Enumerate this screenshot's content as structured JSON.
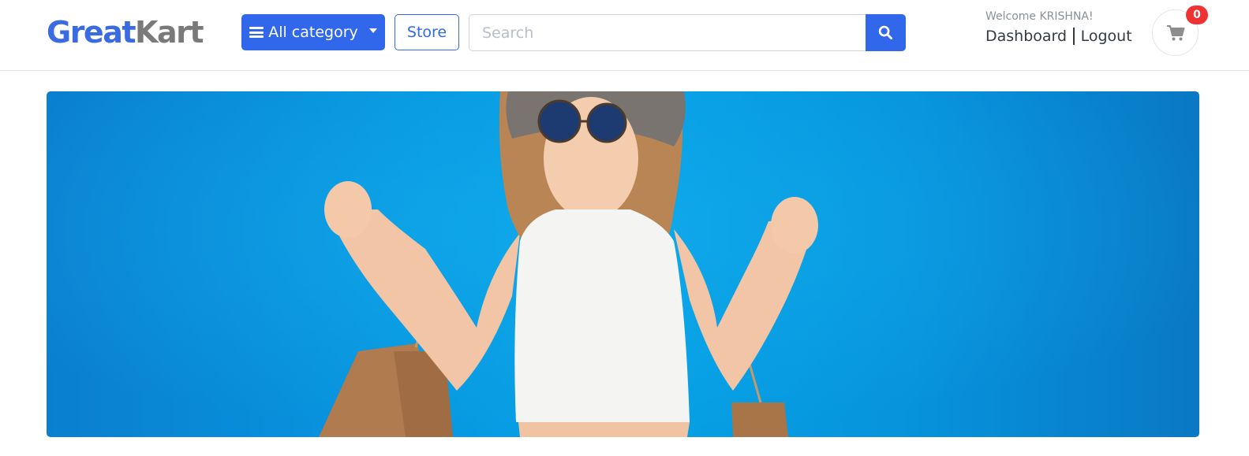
{
  "header": {
    "logo": {
      "part1": "Great",
      "part2": "Kart"
    },
    "category_button": "All category",
    "store_button": "Store",
    "search": {
      "placeholder": "Search",
      "value": ""
    },
    "user": {
      "welcome": "Welcome KRISHNA!",
      "dashboard_link": "Dashboard",
      "logout_link": "Logout"
    },
    "cart": {
      "count": "0"
    }
  },
  "banner": {
    "image": "woman-with-shopping-bags"
  },
  "colors": {
    "primary": "#3167eb",
    "logo_gray": "#7a7a7a",
    "badge": "#f03232",
    "banner_blue": "#069fe4"
  },
  "icons": [
    "bars-icon",
    "caret-down-icon",
    "search-icon",
    "cart-icon"
  ]
}
